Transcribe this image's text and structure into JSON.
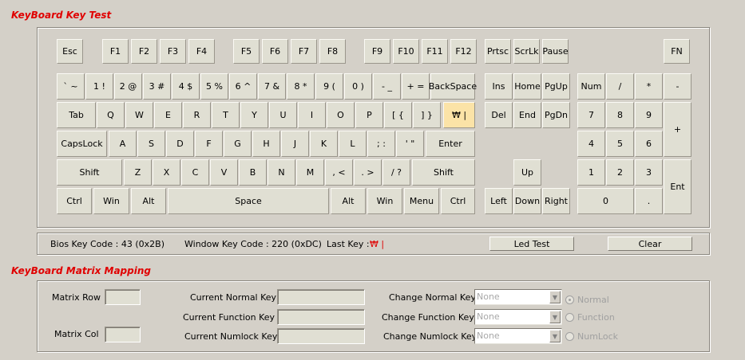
{
  "keyboard_test": {
    "title": "KeyBoard Key Test",
    "keys": {
      "esc": "Esc",
      "f1": "F1",
      "f2": "F2",
      "f3": "F3",
      "f4": "F4",
      "f5": "F5",
      "f6": "F6",
      "f7": "F7",
      "f8": "F8",
      "f9": "F9",
      "f10": "F10",
      "f11": "F11",
      "f12": "F12",
      "prtsc": "Prtsc",
      "scrlk": "ScrLk",
      "pause": "Pause",
      "fn": "FN",
      "grave": "` ~",
      "d1": "1 !",
      "d2": "2 @",
      "d3": "3 #",
      "d4": "4 $",
      "d5": "5 %",
      "d6": "6 ^",
      "d7": "7 &",
      "d8": "8 *",
      "d9": "9 (",
      "d0": "0 )",
      "minus": "- _",
      "equal": "+ =",
      "backspace": "BackSpace",
      "ins": "Ins",
      "home": "Home",
      "pgup": "PgUp",
      "numlock": "Num",
      "numdiv": "/",
      "nummul": "*",
      "numsub": "-",
      "tab": "Tab",
      "q": "Q",
      "w": "W",
      "e": "E",
      "r": "R",
      "t": "T",
      "y": "Y",
      "u": "U",
      "i": "I",
      "o": "O",
      "p": "P",
      "lbracket": "[ {",
      "rbracket": "] }",
      "won": "₩ |",
      "del": "Del",
      "end": "End",
      "pgdn": "PgDn",
      "num7": "7",
      "num8": "8",
      "num9": "9",
      "numadd": "+",
      "caps": "CapsLock",
      "a": "A",
      "s": "S",
      "d": "D",
      "f": "F",
      "g": "G",
      "h": "H",
      "j": "J",
      "k": "K",
      "l": "L",
      "semicolon": "; :",
      "quote": "' \"",
      "enter": "Enter",
      "num4": "4",
      "num5": "5",
      "num6": "6",
      "lshift": "Shift",
      "z": "Z",
      "x": "X",
      "c": "C",
      "v": "V",
      "b": "B",
      "n": "N",
      "m": "M",
      "comma": ", <",
      "period": ". >",
      "slash": "/ ?",
      "rshift": "Shift",
      "up": "Up",
      "num1": "1",
      "num2": "2",
      "num3": "3",
      "numenter": "Ent",
      "lctrl": "Ctrl",
      "lwin": "Win",
      "lalt": "Alt",
      "space": "Space",
      "ralt": "Alt",
      "rwin": "Win",
      "menu": "Menu",
      "rctrl": "Ctrl",
      "left": "Left",
      "down": "Down",
      "right": "Right",
      "num0": "0",
      "numdot": "."
    }
  },
  "status": {
    "bios_key_code": "Bios Key Code : 43 (0x2B)",
    "window_key_code": "Window Key Code : 220 (0xDC)",
    "last_key_label": "Last Key :",
    "last_key_value": "₩ |",
    "led_test_label": "Led Test",
    "clear_label": "Clear"
  },
  "matrix_mapping": {
    "title": "KeyBoard Matrix Mapping",
    "matrix_row_label": "Matrix Row",
    "matrix_col_label": "Matrix Col",
    "current_normal_key_label": "Current Normal Key",
    "current_function_key_label": "Current Function Key",
    "current_numlock_key_label": "Current Numlock Key",
    "change_normal_key_label": "Change Normal Key",
    "change_function_key_label": "Change Function Key",
    "change_numlock_key_label": "Change Numlock Key",
    "change_normal_key_value": "None",
    "change_function_key_value": "None",
    "change_numlock_key_value": "None",
    "radio_normal": "Normal",
    "radio_function": "Function",
    "radio_numlock": "NumLock"
  },
  "colors": {
    "title_red": "#e00000",
    "active_key": "#fbe3a7",
    "background": "#d4d0c8"
  }
}
